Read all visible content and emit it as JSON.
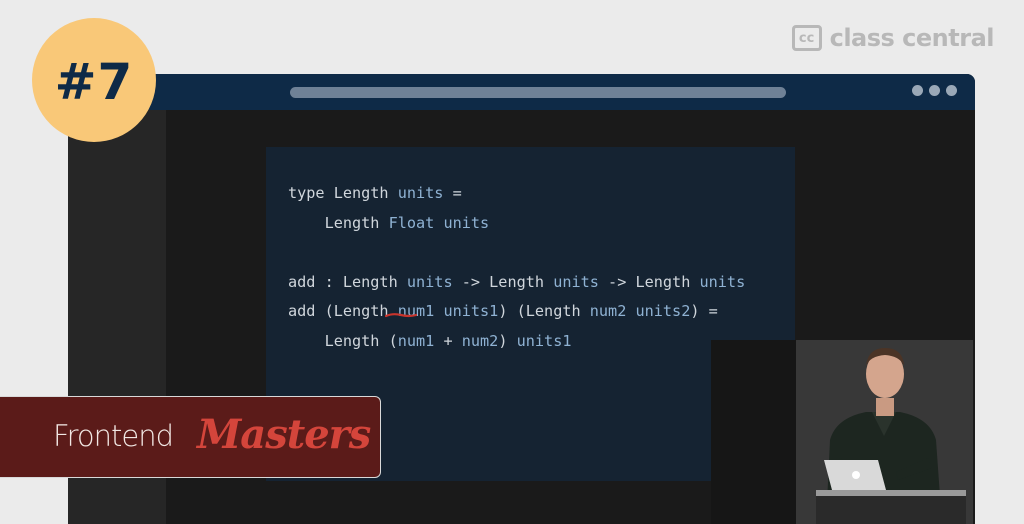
{
  "badge": {
    "label": "#7"
  },
  "brand": {
    "icon_text": "cc",
    "name": "class central"
  },
  "window": {
    "code_lines": [
      [
        {
          "t": "type Length ",
          "c": "k"
        },
        {
          "t": "units",
          "c": "t"
        },
        {
          "t": " =",
          "c": "k"
        }
      ],
      [
        {
          "t": "    Length ",
          "c": "k"
        },
        {
          "t": "Float units",
          "c": "t"
        }
      ],
      [
        {
          "t": "",
          "c": "k"
        }
      ],
      [
        {
          "t": "add : Length ",
          "c": "k"
        },
        {
          "t": "units",
          "c": "t"
        },
        {
          "t": " -> Length ",
          "c": "k"
        },
        {
          "t": "units",
          "c": "t"
        },
        {
          "t": " -> Length ",
          "c": "k"
        },
        {
          "t": "units",
          "c": "t"
        }
      ],
      [
        {
          "t": "add (Length ",
          "c": "k"
        },
        {
          "t": "num1 units1",
          "c": "t"
        },
        {
          "t": ") (Length ",
          "c": "k"
        },
        {
          "t": "num2 units2",
          "c": "t"
        },
        {
          "t": ") =",
          "c": "k"
        }
      ],
      [
        {
          "t": "    Length (",
          "c": "k"
        },
        {
          "t": "num1",
          "c": "t"
        },
        {
          "t": " + ",
          "c": "k"
        },
        {
          "t": "num2",
          "c": "t"
        },
        {
          "t": ") ",
          "c": "k"
        },
        {
          "t": "units1",
          "c": "t"
        }
      ]
    ]
  },
  "provider": {
    "part1": "Frontend",
    "part2": "Masters"
  },
  "colors": {
    "badge": "#f9c878",
    "badge_text": "#0e2a47",
    "titlebar": "#0e2a47",
    "slide": "#152332",
    "keyword": "#d0d6dc",
    "type_var": "#8fb2d3",
    "provider_bg": "#5b1b19",
    "provider_accent": "#d4453b"
  }
}
